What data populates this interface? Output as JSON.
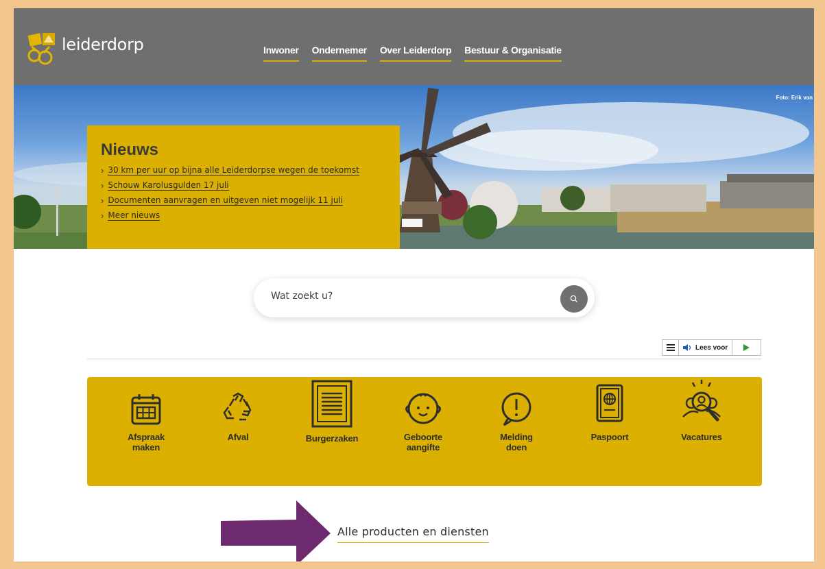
{
  "header": {
    "logo_text": "leiderdorp",
    "nav": [
      "Inwoner",
      "Ondernemer",
      "Over Leiderdorp",
      "Bestuur & Organisatie"
    ]
  },
  "hero": {
    "photo_credit": "Foto: Erik van"
  },
  "news": {
    "title": "Nieuws",
    "items": [
      "30 km per uur op bijna alle Leiderdorpse wegen de toekomst",
      "Schouw Karolusgulden 17 juli",
      "Documenten aanvragen en uitgeven niet mogelijk 11 juli",
      "Meer nieuws"
    ]
  },
  "search": {
    "placeholder": "Wat zoekt u?"
  },
  "readspeaker": {
    "label": "Lees voor"
  },
  "tiles": [
    {
      "line1": "Afspraak",
      "line2": "maken",
      "icon": "calendar-icon"
    },
    {
      "line1": "Afval",
      "line2": "",
      "icon": "recycle-icon"
    },
    {
      "line1": "Burgerzaken",
      "line2": "",
      "icon": "document-icon"
    },
    {
      "line1": "Geboorte",
      "line2": "aangifte",
      "icon": "baby-face-icon"
    },
    {
      "line1": "Melding",
      "line2": "doen",
      "icon": "exclamation-icon"
    },
    {
      "line1": "Paspoort",
      "line2": "",
      "icon": "passport-icon"
    },
    {
      "line1": "Vacatures",
      "line2": "",
      "icon": "search-person-icon"
    }
  ],
  "all_services": {
    "label": "Alle producten en diensten"
  },
  "colors": {
    "accent": "#dcb000",
    "header": "#6f6f6f",
    "frame": "#f4c68f",
    "arrow": "#6e2a6e"
  }
}
